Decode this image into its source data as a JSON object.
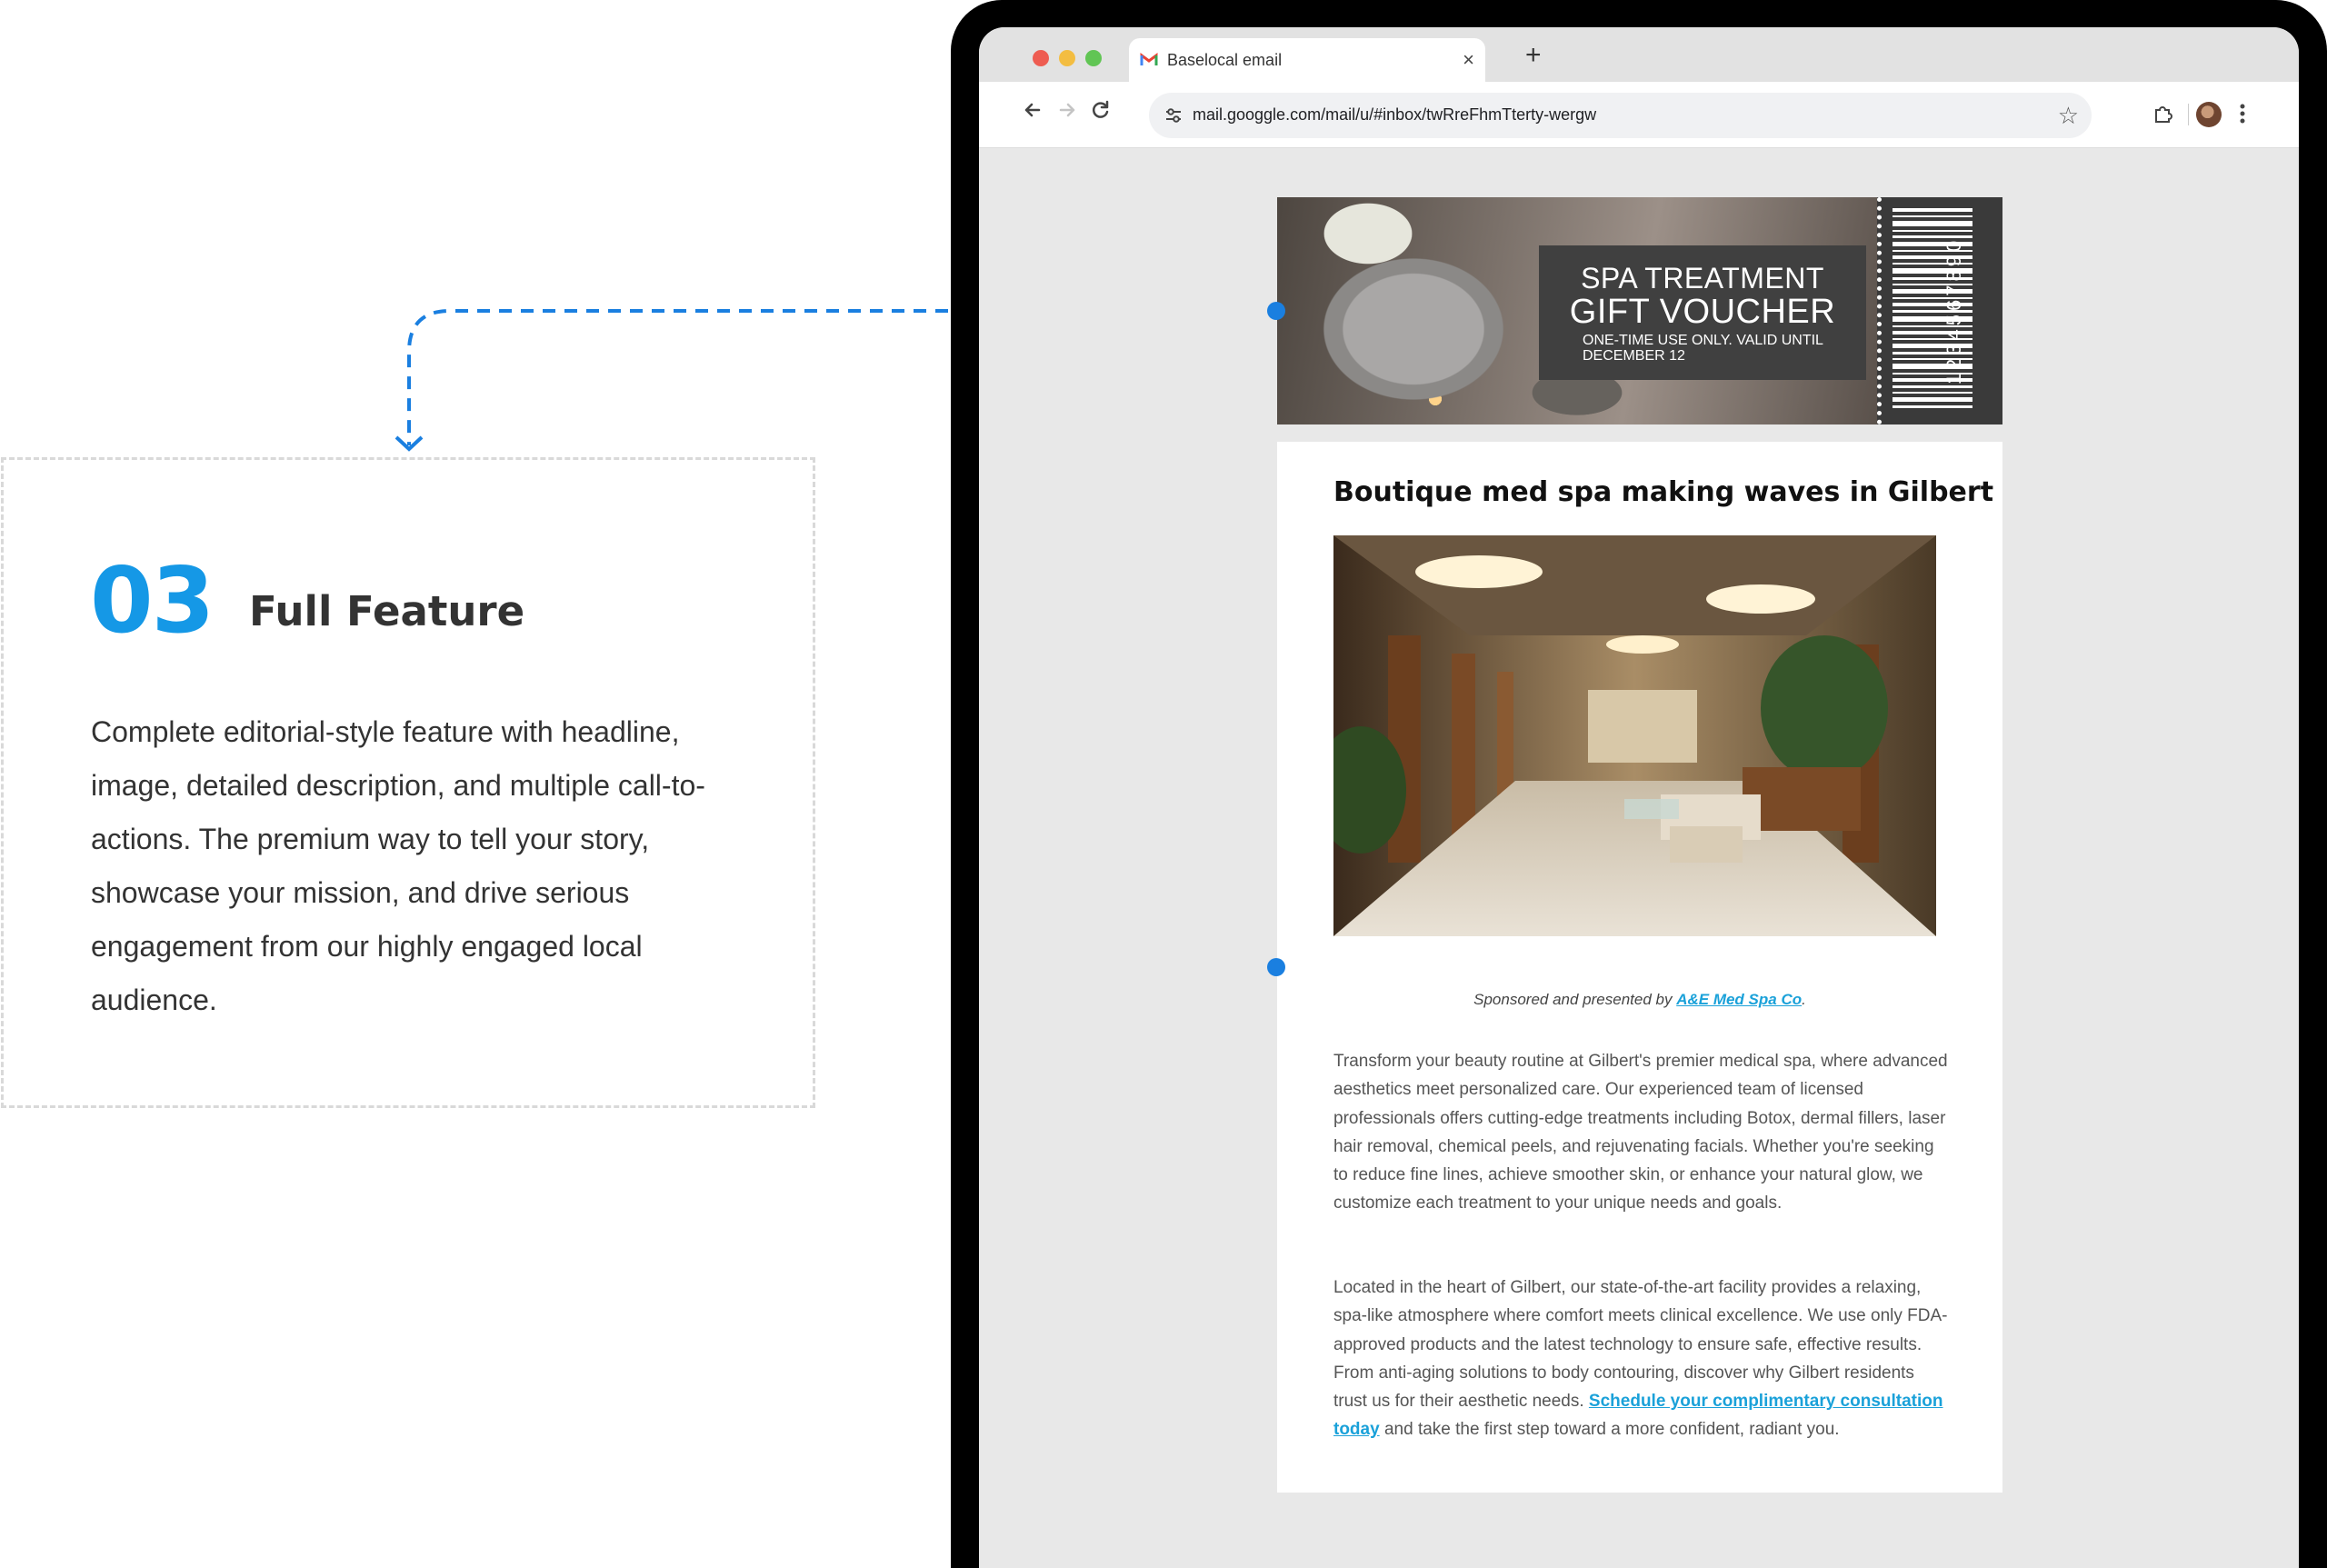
{
  "feature": {
    "number": "03",
    "title": "Full Feature",
    "description": "Complete editorial-style feature with headline, image, detailed description, and multiple call-to-actions. The premium way to tell your story, showcase your mission, and drive serious engagement from our highly engaged local audience."
  },
  "colors": {
    "accent_blue": "#1598e6",
    "connector_blue": "#1a7fe0",
    "link_blue": "#1aa1d9"
  },
  "browser": {
    "tab_title": "Baselocal email",
    "tab_icon": "gmail-icon",
    "url": "mail.googgle.com/mail/u/#inbox/twRreFhmTterty-wergw"
  },
  "voucher": {
    "line1": "SPA TREATMENT",
    "line2": "GIFT VOUCHER",
    "line3": "ONE-TIME USE ONLY. VALID UNTIL DECEMBER 12",
    "barcode_number": "1234567890"
  },
  "email": {
    "headline": "Boutique med spa making waves in Gilbert",
    "sponsor_prefix": "Sponsored and presented by ",
    "sponsor_link": "A&E Med Spa Co",
    "sponsor_suffix": ".",
    "paragraph1": "Transform your beauty routine at Gilbert's premier medical spa, where advanced aesthetics meet personalized care. Our experienced team of licensed professionals offers cutting-edge treatments including Botox, dermal fillers, laser hair removal, chemical peels, and rejuvenating facials. Whether you're seeking to reduce fine lines, achieve smoother skin, or enhance your natural glow, we customize each treatment to your unique needs and goals.",
    "paragraph2_text": "Located in the heart of Gilbert, our state-of-the-art facility provides a relaxing, spa-like atmosphere where comfort meets clinical excellence. We use only FDA-approved products and the latest technology to ensure safe, effective results. From anti-aging solutions to body contouring, discover why Gilbert residents trust us for their aesthetic needs. ",
    "paragraph2_link": "Schedule your complimentary consultation today",
    "paragraph2_end": " and take the first step toward a more confident, radiant you."
  }
}
